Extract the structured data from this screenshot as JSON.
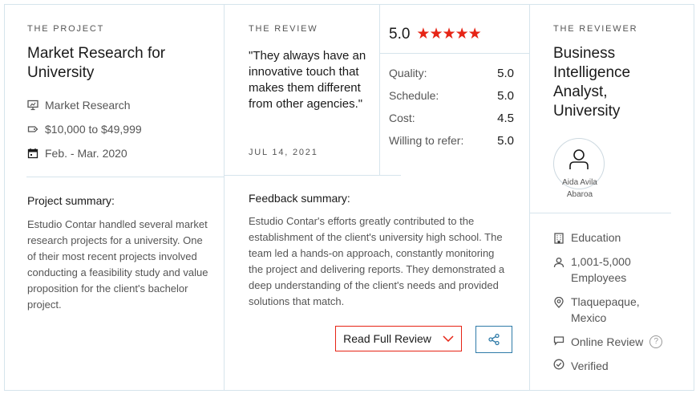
{
  "project": {
    "eyebrow": "THE PROJECT",
    "title": "Market Research for University",
    "service": "Market Research",
    "budget": "$10,000 to $49,999",
    "dates": "Feb. - Mar. 2020",
    "summary_title": "Project summary:",
    "summary": "Estudio Contar handled several market research projects for a university. One of their most recent projects involved conducting a feasibility study and value proposition for the client's bachelor project."
  },
  "review": {
    "eyebrow": "THE REVIEW",
    "quote": "\"They always have an innovative touch that makes them different from other agencies.\"",
    "date": "JUL 14, 2021",
    "rating": "5.0",
    "stars": 5,
    "scores": [
      {
        "label": "Quality:",
        "value": "5.0"
      },
      {
        "label": "Schedule:",
        "value": "5.0"
      },
      {
        "label": "Cost:",
        "value": "4.5"
      },
      {
        "label": "Willing to refer:",
        "value": "5.0"
      }
    ],
    "feedback_title": "Feedback summary:",
    "feedback": "Estudio Contar's efforts greatly contributed to the establishment of the client's university high school. The team led a hands-on approach, constantly monitoring the project and delivering reports. They demonstrated a deep understanding of the client's needs and provided solutions that match.",
    "read_full_label": "Read Full Review"
  },
  "reviewer": {
    "eyebrow": "THE REVIEWER",
    "title": "Business Intelligence Analyst, University",
    "name": "Aida Avila Abaroa",
    "industry": "Education",
    "employees": "1,001-5,000 Employees",
    "location": "Tlaquepaque, Mexico",
    "review_type": "Online Review",
    "verified": "Verified"
  },
  "colors": {
    "accent_red": "#e62415",
    "share_blue": "#2f7ba8",
    "border": "#d6e4ec"
  }
}
